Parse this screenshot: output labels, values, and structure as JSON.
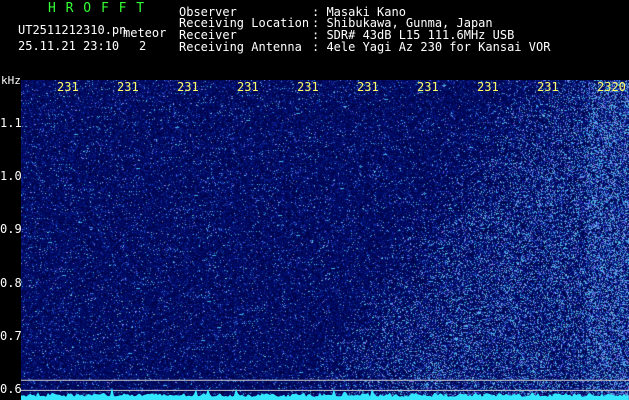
{
  "header": {
    "app_title": "H R O F F T",
    "file_name": "UT2511212310.pn",
    "mode": "meteor",
    "datetime": "25.11.21 23:10",
    "counter": "2",
    "info_rows": [
      {
        "label": "Observer",
        "value": ": Masaki Kano"
      },
      {
        "label": "Receiving Location",
        "value": ": Shibukawa, Gunma, Japan"
      },
      {
        "label": "Receiver",
        "value": ": SDR# 43dB L15 111.6MHz USB"
      },
      {
        "label": "Receiving Antenna",
        "value": ": 4ele Yagi Az 230 for Kansai VOR"
      }
    ]
  },
  "colors": {
    "background": "#000000",
    "spectrum_base": "#000066",
    "spectrum_dot": "#5a6cff",
    "baseline": "#33e6ff",
    "title_green": "#33ff33",
    "tick_yellow": "#ffff66"
  },
  "chart_data": {
    "type": "heatmap",
    "ylabel": "kHz",
    "ylim": [
      0.58,
      1.18
    ],
    "y_ticks": [
      {
        "value": 1.1,
        "label": "1.1"
      },
      {
        "value": 1.0,
        "label": "1.0"
      },
      {
        "value": 0.9,
        "label": "0.9"
      },
      {
        "value": 0.8,
        "label": "0.8"
      },
      {
        "value": 0.7,
        "label": "0.7"
      },
      {
        "value": 0.6,
        "label": "0.6"
      }
    ],
    "x_ticks": [
      "231",
      "231",
      "231",
      "231",
      "231",
      "231",
      "231",
      "231",
      "231",
      "2320"
    ],
    "reference_lines_khz": [
      0.617,
      0.598
    ],
    "activity_region": "lower-right",
    "grid": false
  }
}
